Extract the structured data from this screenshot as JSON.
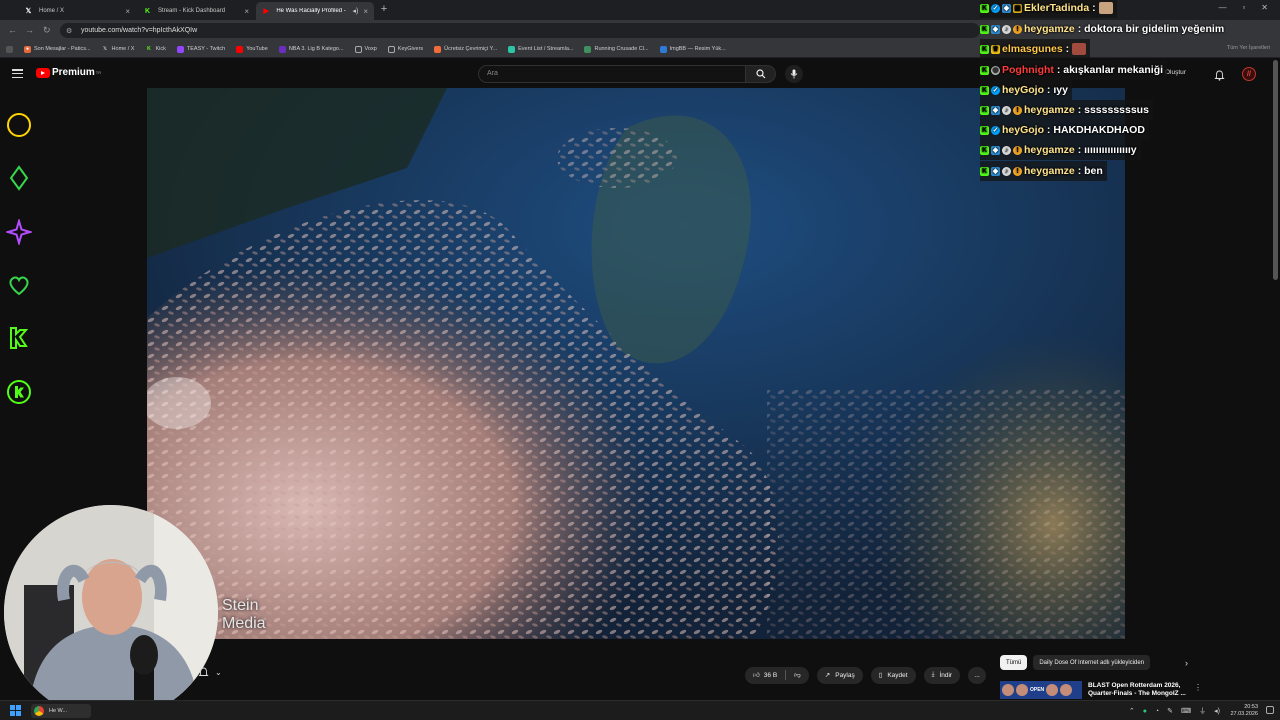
{
  "browser": {
    "tabs": [
      {
        "label": "Home / X",
        "icon": "x-icon",
        "active": false
      },
      {
        "label": "Stream - Kick Dashboard",
        "icon": "kick-icon",
        "active": false
      },
      {
        "label": "He Was Racially Profiled - Yo",
        "icon": "youtube-icon",
        "active": true
      }
    ],
    "new_tab": "+",
    "url": "youtube.com/watch?v=hpIcthAkXQIw",
    "bookmarks": [
      "Son Mesajlar - Patics...",
      "Home / X",
      "Kick",
      "TEASY - Twitch",
      "YouTube",
      "NBA 3. Lig B Katego...",
      "Voxp",
      "KeyGivers",
      "Ücretsiz Çevrimiçi Y...",
      "Event List / Streamla...",
      "Running Crusade Cl...",
      "ImgBB — Resim Yük..."
    ],
    "bookmarks_right": "Tüm Yer İşaretleri"
  },
  "youtube": {
    "logo": "Premium",
    "logo_sup": "TR",
    "search_placeholder": "Ara",
    "create_label": "Oluştur",
    "watermark_line1": "Stein",
    "watermark_line2": "Media",
    "actions": {
      "likes": "36 B",
      "share": "Paylaş",
      "save": "Kaydet",
      "download": "İndir",
      "more": "..."
    },
    "chips": {
      "all": "Tümü",
      "uploader": "Daily Dose Of Internet adlı yükleyiciden"
    },
    "rec_title": "BLAST Open Rotterdam 2026, Quarter-Finals - The MongolZ ...",
    "rec_thumb_text": "OPEN"
  },
  "chat": [
    {
      "user": "EklerTadinda",
      "msg": "",
      "color": "#ffe38a",
      "bg": true
    },
    {
      "user": "heygamze",
      "msg": "doktora bir gidelim yeğenim",
      "color": "#ffe38a",
      "bg": false
    },
    {
      "user": "elmasgunes",
      "msg": "",
      "color": "#ffc94a",
      "bg": true
    },
    {
      "user": "Poghnight",
      "msg": "akışkanlar mekaniği",
      "color": "#ff3b3b",
      "bg": true
    },
    {
      "user": "heyGojo",
      "msg": "ıyy",
      "color": "#ffe38a",
      "bg": true
    },
    {
      "user": "heygamze",
      "msg": "sssssssssus",
      "color": "#ffe38a",
      "bg": true
    },
    {
      "user": "heyGojo",
      "msg": "HAKDHAKDHAOD",
      "color": "#ffe38a",
      "bg": true
    },
    {
      "user": "heygamze",
      "msg": "ııııııııııııııııy",
      "color": "#ffe38a",
      "bg": true
    },
    {
      "user": "heygamze",
      "msg": "ben",
      "color": "#ffe38a",
      "bg": true
    }
  ],
  "taskbar": {
    "chrome_label": "He W...",
    "time": "20:53",
    "date": "27.03.2026"
  },
  "colors": {
    "kick_green": "#53fc18",
    "youtube_red": "#ff0000",
    "neon_yellow": "#ffd400",
    "neon_green": "#38d64a",
    "neon_purple": "#b34dff"
  }
}
